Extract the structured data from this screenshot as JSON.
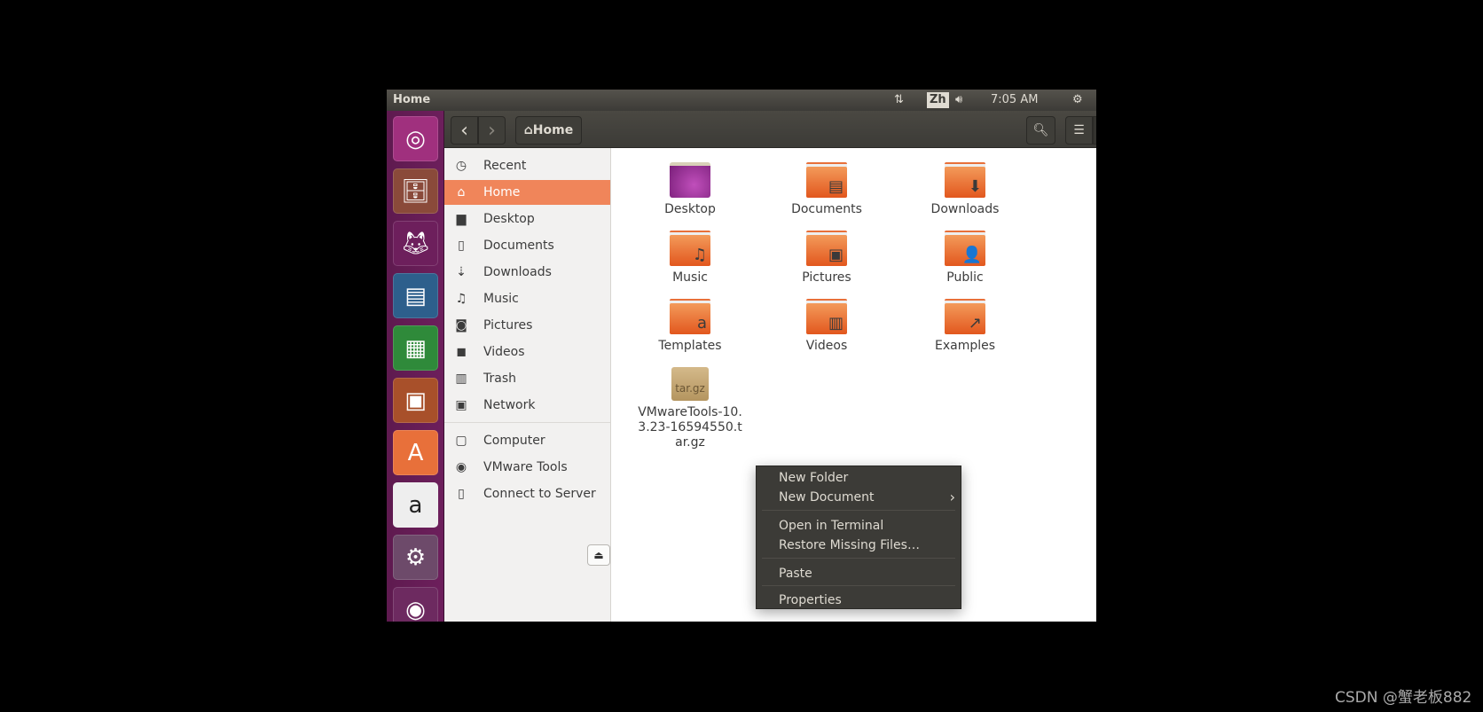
{
  "window": {
    "title": "Home"
  },
  "panel": {
    "clock": "7:05 AM",
    "input_method": "Zh",
    "icons": [
      "network-updown-icon",
      "volume-icon",
      "power-gear-icon"
    ]
  },
  "launcher": [
    "Ubuntu Dash",
    "Files",
    "Firefox",
    "LibreOffice Writer",
    "LibreOffice Calc",
    "LibreOffice Impress",
    "Ubuntu Software",
    "Amazon",
    "System Settings",
    "DVD"
  ],
  "toolbar": {
    "back": "‹",
    "forward": "›",
    "path": "Home"
  },
  "sidebar": {
    "items": [
      {
        "label": "Recent",
        "icon": "clock-icon",
        "glyph": "◷"
      },
      {
        "label": "Home",
        "icon": "home-icon",
        "glyph": "⌂",
        "active": true
      },
      {
        "label": "Desktop",
        "icon": "folder-icon",
        "glyph": "▆"
      },
      {
        "label": "Documents",
        "icon": "document-icon",
        "glyph": "▯"
      },
      {
        "label": "Downloads",
        "icon": "download-icon",
        "glyph": "⇣"
      },
      {
        "label": "Music",
        "icon": "music-icon",
        "glyph": "♫"
      },
      {
        "label": "Pictures",
        "icon": "camera-icon",
        "glyph": "◙"
      },
      {
        "label": "Videos",
        "icon": "video-icon",
        "glyph": "◼"
      },
      {
        "label": "Trash",
        "icon": "trash-icon",
        "glyph": "▥"
      },
      {
        "label": "Network",
        "icon": "network-icon",
        "glyph": "▣"
      }
    ],
    "devices": [
      {
        "label": "Computer",
        "icon": "computer-icon",
        "glyph": "▢"
      },
      {
        "label": "VMware Tools",
        "icon": "disc-icon",
        "glyph": "◉"
      },
      {
        "label": "Connect to Server",
        "icon": "server-icon",
        "glyph": "▯"
      }
    ]
  },
  "files": [
    {
      "name": "Desktop",
      "kind": "desktop"
    },
    {
      "name": "Documents",
      "kind": "folder",
      "emblem": "▤"
    },
    {
      "name": "Downloads",
      "kind": "folder",
      "emblem": "⬇"
    },
    {
      "name": "Music",
      "kind": "folder",
      "emblem": "♫"
    },
    {
      "name": "Pictures",
      "kind": "folder",
      "emblem": "▣"
    },
    {
      "name": "Public",
      "kind": "folder",
      "emblem": "👤"
    },
    {
      "name": "Templates",
      "kind": "folder",
      "emblem": "a"
    },
    {
      "name": "Videos",
      "kind": "folder",
      "emblem": "▥"
    },
    {
      "name": "Examples",
      "kind": "folder",
      "emblem": "↗"
    },
    {
      "name": "VMwareTools-10.3.23-16594550.tar.gz",
      "kind": "archive",
      "badge": "tar.gz"
    }
  ],
  "context_menu": {
    "items": [
      "New Folder",
      "New Document",
      "Open in Terminal",
      "Restore Missing Files…",
      "Paste",
      "Properties"
    ],
    "submenu_arrow": "›"
  },
  "watermark": "CSDN @蟹老板882"
}
